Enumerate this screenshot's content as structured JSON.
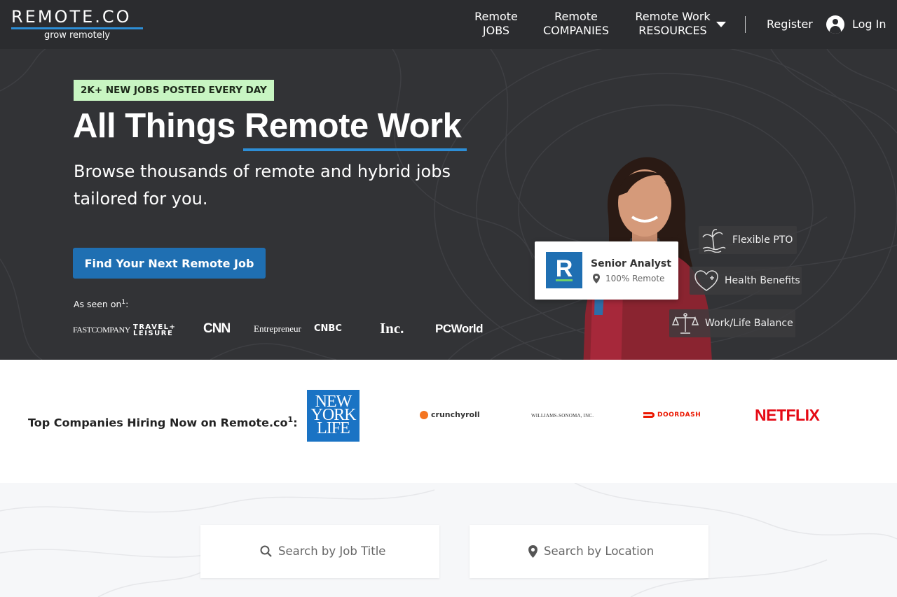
{
  "header": {
    "logo_text": "REMOTE.CO",
    "logo_tagline": "grow remotely",
    "nav": [
      {
        "line1": "Remote",
        "line2": "JOBS"
      },
      {
        "line1": "Remote",
        "line2": "COMPANIES"
      },
      {
        "line1": "Remote Work",
        "line2": "RESOURCES"
      }
    ],
    "register": "Register",
    "login": "Log In"
  },
  "hero": {
    "badge": "2K+ NEW JOBS POSTED EVERY DAY",
    "headline": "All Things Remote Work",
    "subhead": "Browse thousands of remote and hybrid jobs tailored for you.",
    "cta": "Find Your Next Remote Job",
    "seen_on": "As seen on",
    "seen_on_sup": "1",
    "press": [
      "FASTCOMPANY",
      "TRAVEL+ LEISURE",
      "CNN",
      "Entrepreneur",
      "CNBC",
      "Inc.",
      "PCWorld"
    ],
    "job_card": {
      "logo_letter": "R",
      "title": "Senior Analyst",
      "location": "100% Remote"
    },
    "perks": [
      "Flexible PTO",
      "Health Benefits",
      "Work/Life Balance"
    ]
  },
  "companies": {
    "title": "Top Companies Hiring Now on Remote.co",
    "title_sup": "1",
    "logos": [
      "NEW YORK LIFE",
      "crunchyroll",
      "WILLIAMS-SONOMA, INC.",
      "DOORDASH",
      "NETFLIX"
    ]
  },
  "search": {
    "job_placeholder": "Search by Job Title",
    "location_placeholder": "Search by Location"
  },
  "colors": {
    "header_bg": "#2b2c2f",
    "hero_bg": "#323336",
    "accent_blue": "#2d8ed6",
    "cta_blue": "#1f6fb2",
    "badge_green": "#c8f5c2",
    "netflix_red": "#e50914",
    "doordash_red": "#eb1700"
  }
}
